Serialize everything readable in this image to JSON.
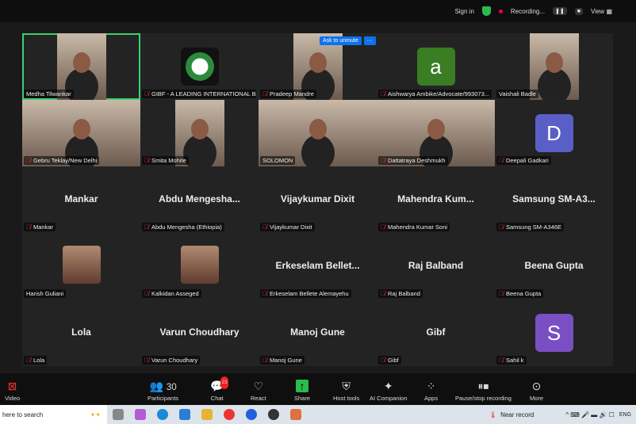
{
  "topbar": {
    "sign_in": "Sign in",
    "recording": "Recording...",
    "view": "View"
  },
  "popup": {
    "ask_to_unmute": "Ask to unmute",
    "more": "···"
  },
  "tiles": [
    {
      "name": "Medha Tilwankar",
      "kind": "video",
      "muted": false,
      "active": true
    },
    {
      "name": "GIBF - A LEADING INTERNATIONAL B...",
      "kind": "logo",
      "muted": true
    },
    {
      "name": "Pradeep Mandre",
      "kind": "video",
      "muted": true
    },
    {
      "name": "Aishwarya Ambike/Advocate/993073...",
      "kind": "letter",
      "letter": "a",
      "color": "#3a7d23",
      "muted": true
    },
    {
      "name": "Vaishali Badle",
      "kind": "video",
      "muted": false
    },
    {
      "name": "Gebru Teklay/New Delhi",
      "kind": "videowide",
      "muted": true
    },
    {
      "name": "Smita Mohite",
      "kind": "video",
      "muted": true
    },
    {
      "name": "SOLOMON",
      "kind": "videowide",
      "muted": false
    },
    {
      "name": "Dattatraya Deshmukh",
      "kind": "videowide",
      "muted": true
    },
    {
      "name": "Deepali Gadkari",
      "kind": "letter",
      "letter": "D",
      "color": "#5a5fc8",
      "muted": true
    },
    {
      "name": "Mankar",
      "big": "Mankar",
      "kind": "name",
      "muted": true
    },
    {
      "name": "Abdu Mengesha (Ethiopia)",
      "big": "Abdu Mengesha...",
      "kind": "name",
      "muted": true
    },
    {
      "name": "Vijaykumar Dixit",
      "big": "Vijaykumar Dixit",
      "kind": "name",
      "muted": true
    },
    {
      "name": "Mahendra Kumar Soni",
      "big": "Mahendra Kum...",
      "kind": "name",
      "muted": true
    },
    {
      "name": "Samsung SM-A346E",
      "big": "Samsung SM-A3...",
      "kind": "name",
      "muted": true
    },
    {
      "name": "Harish Guliani",
      "kind": "photo",
      "muted": false
    },
    {
      "name": "Kalkidan Asseged",
      "kind": "photo",
      "muted": true
    },
    {
      "name": "Erkeselam Bellete Alemayehu",
      "big": "Erkeselam Bellet...",
      "kind": "name",
      "muted": true
    },
    {
      "name": "Raj Balband",
      "big": "Raj Balband",
      "kind": "name",
      "muted": true
    },
    {
      "name": "Beena Gupta",
      "big": "Beena Gupta",
      "kind": "name",
      "muted": true
    },
    {
      "name": "Lola",
      "big": "Lola",
      "kind": "name",
      "muted": true
    },
    {
      "name": "Varun Choudhary",
      "big": "Varun Choudhary",
      "kind": "name",
      "muted": true
    },
    {
      "name": "Manoj Gune",
      "big": "Manoj Gune",
      "kind": "name",
      "muted": true
    },
    {
      "name": "Gibf",
      "big": "Gibf",
      "kind": "name",
      "muted": true
    },
    {
      "name": "Sahil k",
      "kind": "letter",
      "letter": "S",
      "color": "#7a4fc4",
      "muted": true
    }
  ],
  "toolbar": {
    "video": "Video",
    "participants": "Participants",
    "participants_count": "30",
    "chat": "Chat",
    "chat_badge": "23",
    "react": "React",
    "share": "Share",
    "host_tools": "Host tools",
    "ai_companion": "AI Companion",
    "apps": "Apps",
    "recording": "Pause/stop recording",
    "more": "More"
  },
  "taskbar": {
    "search": "here to search",
    "weather": "Near record",
    "lang": "ENG"
  }
}
